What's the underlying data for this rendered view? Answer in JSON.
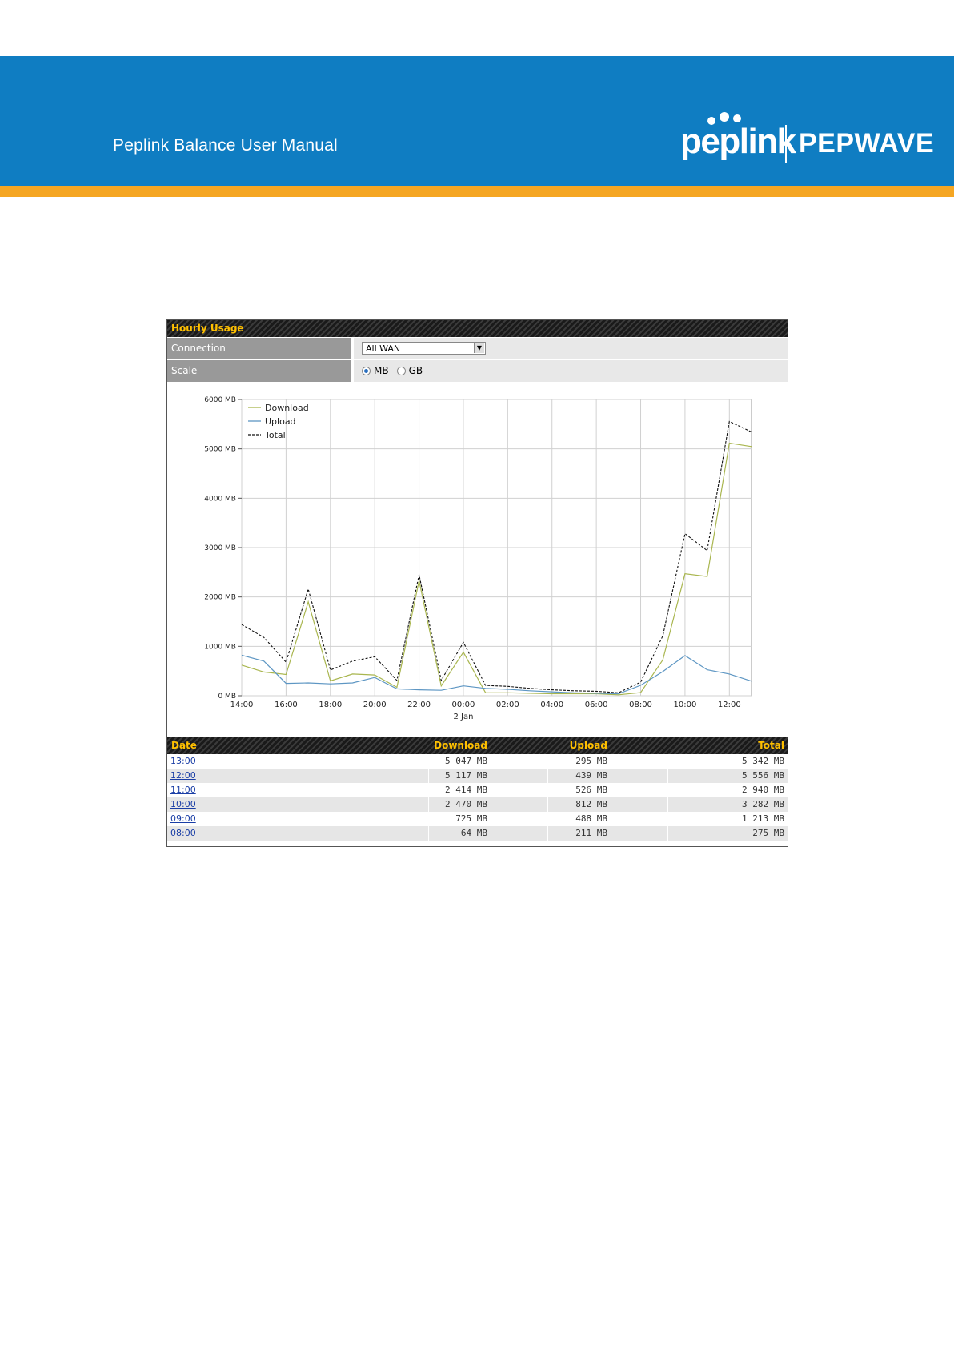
{
  "document": {
    "header_title": "Peplink Balance User Manual",
    "logo_left": "peplink",
    "logo_right": "PEPWAVE",
    "colors": {
      "banner": "#0f7dc2",
      "stripe": "#f5a623",
      "panel_accent": "#ffc000"
    }
  },
  "panel": {
    "title": "Hourly Usage",
    "connection_label": "Connection",
    "connection_value": "All WAN",
    "scale_label": "Scale",
    "scale_options": [
      "MB",
      "GB"
    ],
    "scale_selected": "MB"
  },
  "chart_data": {
    "type": "line",
    "legend_placement": "top-left",
    "grid": true,
    "x": [
      "14:00",
      "15:00",
      "16:00",
      "17:00",
      "18:00",
      "19:00",
      "20:00",
      "21:00",
      "22:00",
      "23:00",
      "00:00",
      "01:00",
      "02:00",
      "03:00",
      "04:00",
      "05:00",
      "06:00",
      "07:00",
      "08:00",
      "09:00",
      "10:00",
      "11:00",
      "12:00",
      "13:00"
    ],
    "x_tick_labels": [
      "14:00",
      "16:00",
      "18:00",
      "20:00",
      "22:00",
      "00:00",
      "02:00",
      "04:00",
      "06:00",
      "08:00",
      "10:00",
      "12:00"
    ],
    "x_sub_label": "2 Jan",
    "y_tick_labels": [
      "0 MB",
      "1000 MB",
      "2000 MB",
      "3000 MB",
      "4000 MB",
      "5000 MB",
      "6000 MB"
    ],
    "ylim": [
      0,
      6000
    ],
    "series": [
      {
        "name": "Download",
        "color": "#a9b64f",
        "dash": false,
        "values": [
          620,
          480,
          430,
          1900,
          300,
          440,
          420,
          170,
          2330,
          200,
          880,
          60,
          60,
          50,
          40,
          40,
          40,
          20,
          64,
          725,
          2470,
          2414,
          5117,
          5047
        ]
      },
      {
        "name": "Upload",
        "color": "#5d96c3",
        "dash": false,
        "values": [
          820,
          700,
          250,
          260,
          240,
          260,
          370,
          140,
          120,
          110,
          200,
          150,
          130,
          100,
          80,
          60,
          50,
          40,
          211,
          488,
          812,
          526,
          439,
          295
        ]
      },
      {
        "name": "Total",
        "color": "#111111",
        "dash": true,
        "values": [
          1440,
          1180,
          680,
          2160,
          520,
          700,
          790,
          310,
          2450,
          310,
          1080,
          210,
          190,
          150,
          120,
          100,
          90,
          60,
          275,
          1213,
          3282,
          2940,
          5556,
          5342
        ]
      }
    ]
  },
  "table": {
    "headers": {
      "date": "Date",
      "download": "Download",
      "upload": "Upload",
      "total": "Total"
    },
    "rows": [
      {
        "date": "13:00",
        "download": "5 047 MB",
        "upload": "295 MB",
        "total": "5 342 MB"
      },
      {
        "date": "12:00",
        "download": "5 117 MB",
        "upload": "439 MB",
        "total": "5 556 MB"
      },
      {
        "date": "11:00",
        "download": "2 414 MB",
        "upload": "526 MB",
        "total": "2 940 MB"
      },
      {
        "date": "10:00",
        "download": "2 470 MB",
        "upload": "812 MB",
        "total": "3 282 MB"
      },
      {
        "date": "09:00",
        "download": "725 MB",
        "upload": "488 MB",
        "total": "1 213 MB"
      },
      {
        "date": "08:00",
        "download": "64 MB",
        "upload": "211 MB",
        "total": "275 MB"
      }
    ]
  }
}
